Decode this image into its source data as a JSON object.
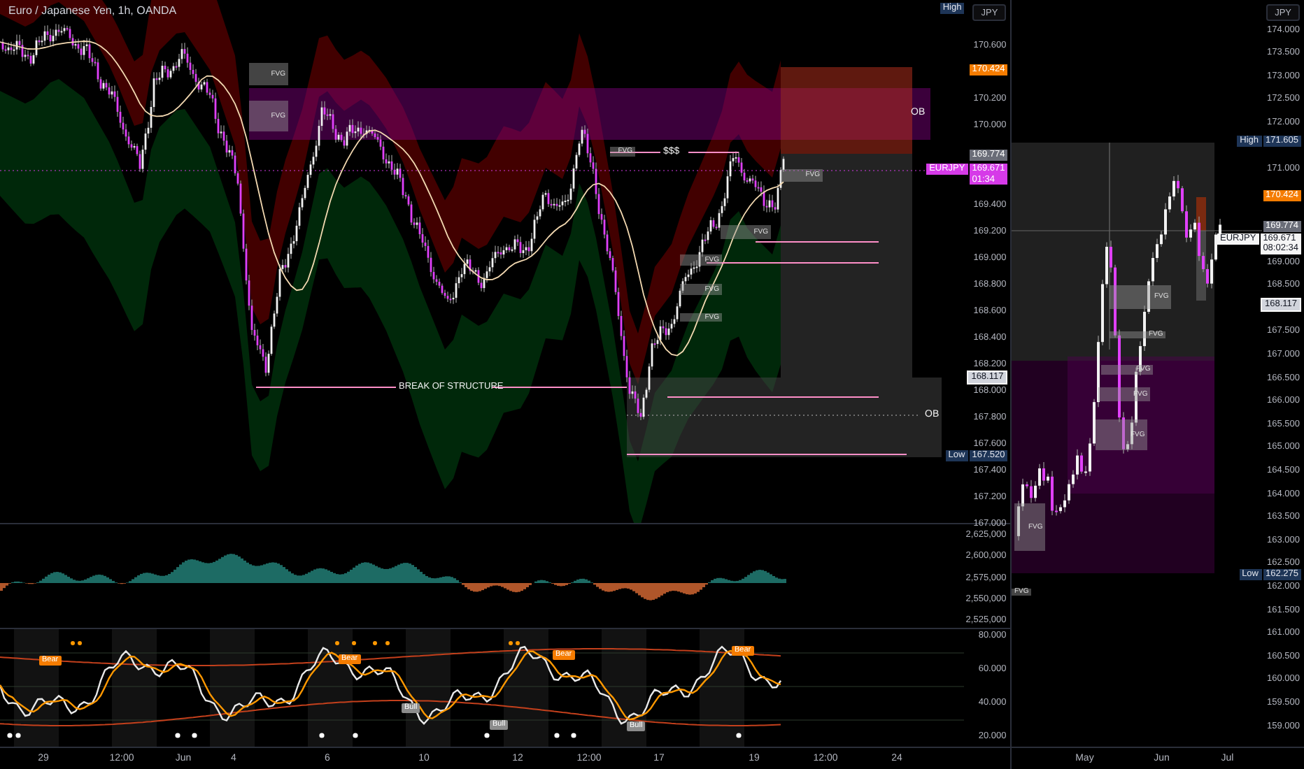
{
  "chart_title": "Euro / Japanese Yen, 1h, OANDA",
  "main_chart": {
    "fvg_labels": [
      "FVG",
      "FVG",
      "FVG",
      "FVG",
      "FVG",
      "FVG",
      "FVG",
      "FVG"
    ],
    "order_block_labels": [
      "OB",
      "OB"
    ],
    "liquidity_label": "$$$",
    "structure_label": "BREAK OF STRUCTURE"
  },
  "price_axis": {
    "currency": "JPY",
    "high": {
      "tag": "High"
    },
    "ticks": [
      "170.600",
      "170.200",
      "170.000",
      "169.400",
      "169.200",
      "169.000",
      "168.800",
      "168.600",
      "168.400",
      "168.200",
      "168.000",
      "167.800",
      "167.600",
      "167.400",
      "167.200",
      "167.000"
    ],
    "markers": [
      {
        "kind": "target",
        "price": "170.424"
      },
      {
        "kind": "previous",
        "price": "169.774"
      },
      {
        "kind": "current",
        "symbol": "EURJPY",
        "price": "169.671",
        "countdown": "01:34",
        "highlighted": true
      },
      {
        "kind": "reference",
        "price": "168.117"
      }
    ],
    "low": {
      "tag": "Low",
      "price": "167.520"
    }
  },
  "volume_axis": {
    "ticks": [
      "2,625,000",
      "2,600,000",
      "2,575,000",
      "2,550,000",
      "2,525,000"
    ]
  },
  "oscillator": {
    "signals": [
      {
        "kind": "bear",
        "text": "Bear"
      },
      {
        "kind": "bear",
        "text": "Bear"
      },
      {
        "kind": "bull",
        "text": "Bull"
      },
      {
        "kind": "bull",
        "text": "Bull"
      },
      {
        "kind": "bear",
        "text": "Bear"
      },
      {
        "kind": "bull",
        "text": "Bull"
      },
      {
        "kind": "bear",
        "text": "Bear"
      }
    ],
    "ticks": [
      "80.000",
      "60.000",
      "40.000",
      "20.000"
    ]
  },
  "time_axis": {
    "ticks": [
      "29",
      "12:00",
      "Jun",
      "4",
      "6",
      "10",
      "12",
      "12:00",
      "17",
      "19",
      "12:00",
      "24"
    ]
  },
  "right_chart": {
    "fvg_labels": [
      "FVG",
      "FVG",
      "FVG",
      "FVG",
      "FVG",
      "FVG",
      "FVG"
    ],
    "price_axis": {
      "currency": "JPY",
      "high": {
        "tag": "High",
        "price": "171.605"
      },
      "ticks": [
        "174.000",
        "173.500",
        "173.000",
        "172.500",
        "172.000",
        "171.000",
        "169.000",
        "168.500",
        "167.500",
        "167.000",
        "166.500",
        "166.000",
        "165.500",
        "165.000",
        "164.500",
        "164.000",
        "163.500",
        "163.000",
        "162.500",
        "162.000",
        "161.500",
        "161.000",
        "160.500",
        "160.000",
        "159.500",
        "159.000"
      ],
      "markers": [
        {
          "kind": "target",
          "price": "170.424"
        },
        {
          "kind": "previous",
          "price": "169.774"
        },
        {
          "kind": "current",
          "symbol": "EURJPY",
          "price": "169.671",
          "countdown": "08:02:34",
          "highlighted": false
        },
        {
          "kind": "reference",
          "price": "168.117"
        }
      ],
      "low": {
        "tag": "Low",
        "price": "162.275"
      }
    },
    "time_axis": {
      "ticks": [
        "May",
        "Jun",
        "Jul"
      ]
    }
  }
}
